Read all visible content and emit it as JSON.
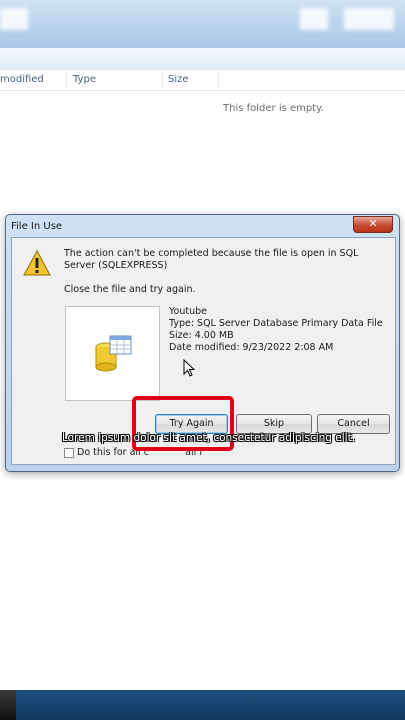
{
  "explorer": {
    "columns": {
      "modified": "modified",
      "type": "Type",
      "size": "Size"
    },
    "empty_message": "This folder is empty."
  },
  "dialog": {
    "title": "File In Use",
    "close_label": "✕",
    "message_line1": "The action can't be completed because the file is open in SQL Server (SQLEXPRESS)",
    "message_line2": "Close the file and try again.",
    "file": {
      "name": "Youtube",
      "type": "Type: SQL Server Database Primary Data File",
      "size": "Size: 4.00 MB",
      "date_modified": "Date modified: 9/23/2022 2:08 AM"
    },
    "buttons": {
      "try_again": "Try Again",
      "skip": "Skip",
      "cancel": "Cancel"
    },
    "checkbox_label": "Do this for all c            all f         "
  },
  "caption": "Lorem ipsum dolor sit amet, consectetur adipiscing elit.",
  "colors": {
    "highlight": "#e0001a",
    "dialog_frame": "#bad2ea",
    "taskbar": "#1d4f7e"
  }
}
